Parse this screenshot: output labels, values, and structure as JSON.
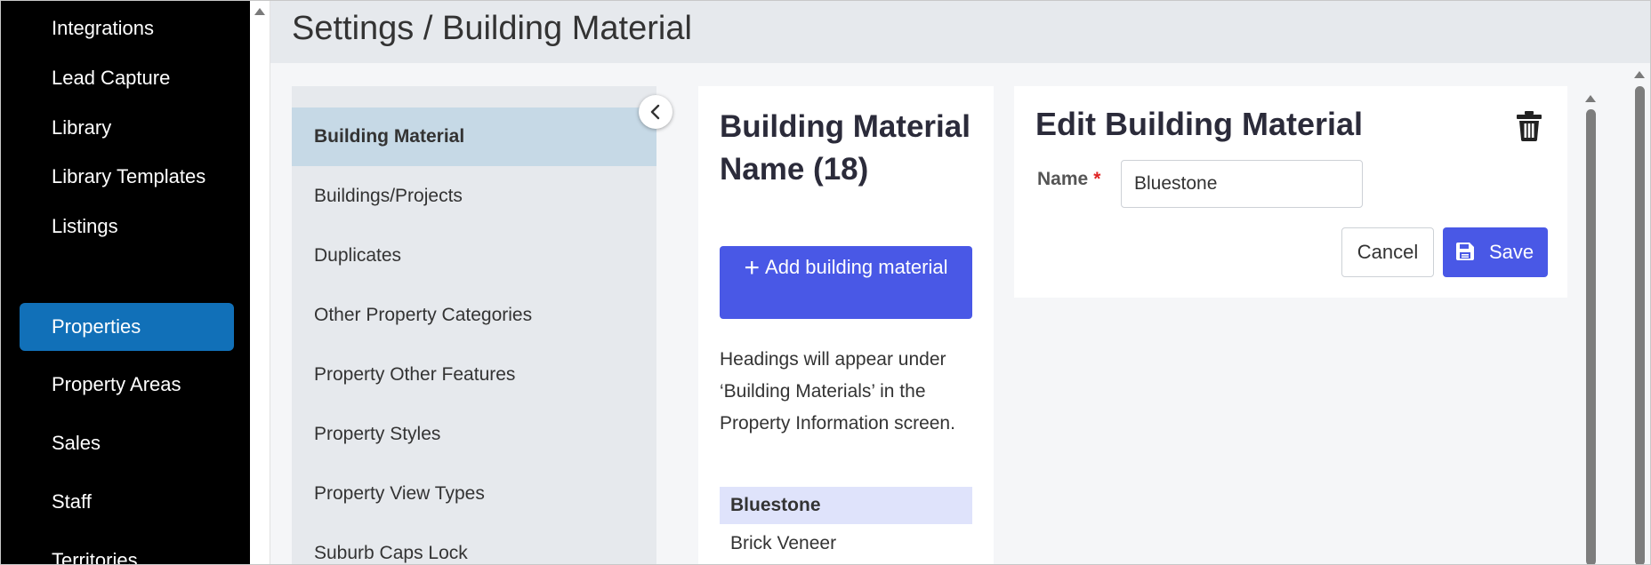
{
  "nav": {
    "items": [
      {
        "label": "Integrations"
      },
      {
        "label": "Lead Capture"
      },
      {
        "label": "Library"
      },
      {
        "label": "Library Templates"
      },
      {
        "label": "Listings"
      },
      {
        "label": "Properties"
      },
      {
        "label": "Property Areas"
      },
      {
        "label": "Sales"
      },
      {
        "label": "Staff"
      },
      {
        "label": "Territories"
      }
    ],
    "active": "Properties"
  },
  "header": {
    "title": "Settings / Building Material"
  },
  "settings_menu": {
    "items": [
      {
        "label": "Building Material"
      },
      {
        "label": "Buildings/Projects"
      },
      {
        "label": "Duplicates"
      },
      {
        "label": "Other Property Categories"
      },
      {
        "label": "Property Other Features"
      },
      {
        "label": "Property Styles"
      },
      {
        "label": "Property View Types"
      },
      {
        "label": "Suburb Caps Lock"
      }
    ],
    "active": "Building Material"
  },
  "list_panel": {
    "title": "Building Material Name (18)",
    "add_button_label": "Add building material",
    "help_text": "Headings will appear under ‘Building Materials’ in the Property Information screen.",
    "materials": [
      {
        "label": "Bluestone"
      },
      {
        "label": "Brick Veneer"
      }
    ],
    "selected": "Bluestone"
  },
  "edit_panel": {
    "title": "Edit Building Material",
    "name_label": "Name",
    "required_marker": "*",
    "name_value": "Bluestone",
    "cancel_label": "Cancel",
    "save_label": "Save"
  },
  "colors": {
    "nav_bg": "#000000",
    "nav_active": "#1170b8",
    "primary_button": "#4958e6",
    "selected_row": "#dfe3fb",
    "settings_active": "#c6d9e6",
    "required": "#e02424"
  },
  "icons": {
    "collapse": "chevron-left-icon",
    "add": "plus-icon",
    "delete": "trash-icon",
    "save": "floppy-disk-icon"
  }
}
